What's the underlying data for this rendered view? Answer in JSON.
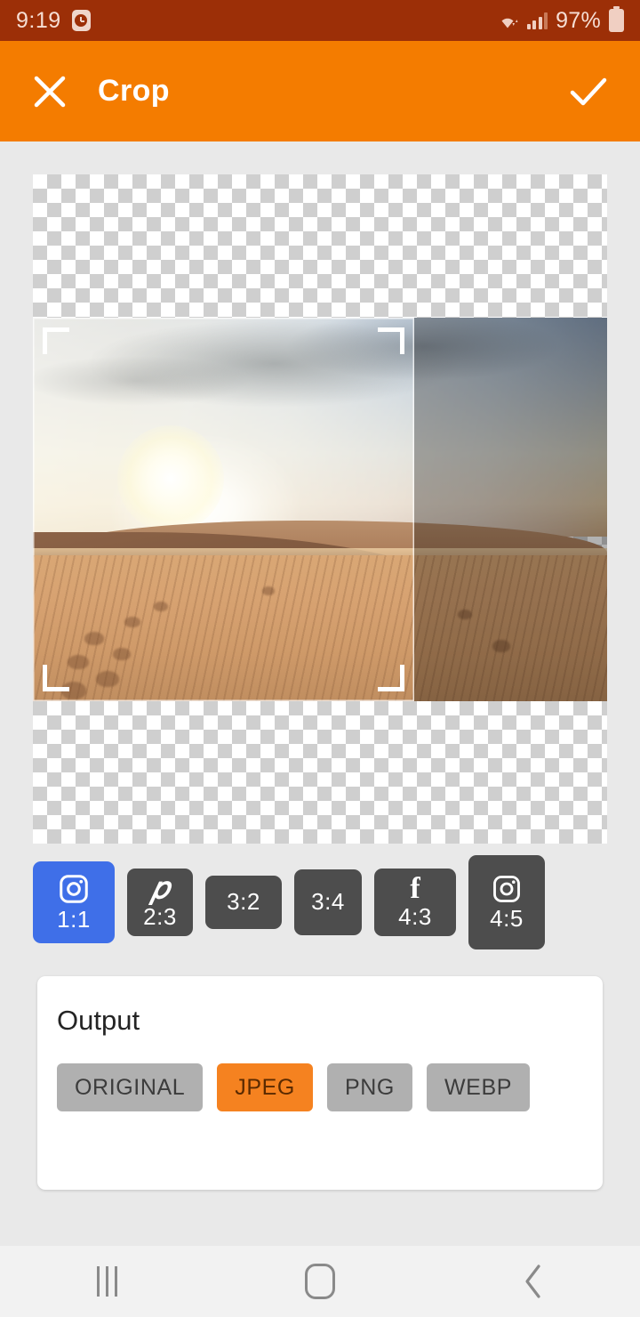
{
  "status_bar": {
    "time": "9:19",
    "alarm_icon": "alarm-clock-icon",
    "wifi_icon": "wifi-icon",
    "signal_icon": "cellular-signal-icon",
    "battery_percent": "97%",
    "battery_icon": "battery-icon",
    "background_color": "#9c2f07"
  },
  "app_bar": {
    "close_icon": "close-icon",
    "title": "Crop",
    "done_icon": "checkmark-icon",
    "background_color": "#f47c00"
  },
  "editor": {
    "canvas_background": "transparent-checkerboard",
    "image_description": "desert sand dunes at sunset with footprints in the sand",
    "crop_overlay": {
      "aspect": "1:1",
      "handles": [
        "top-left",
        "top-right",
        "bottom-left",
        "bottom-right"
      ],
      "outside_shade_color": "rgba(0,0,0,0.30)"
    }
  },
  "aspect_ratios": {
    "selected": "1:1",
    "selected_color": "#3f6fe8",
    "unselected_color": "#4d4d4d",
    "items": [
      {
        "label": "1:1",
        "icon": "instagram-icon",
        "selected": true
      },
      {
        "label": "2:3",
        "icon": "pinterest-icon",
        "selected": false
      },
      {
        "label": "3:2",
        "icon": "",
        "selected": false
      },
      {
        "label": "3:4",
        "icon": "",
        "selected": false
      },
      {
        "label": "4:3",
        "icon": "facebook-icon",
        "selected": false
      },
      {
        "label": "4:5",
        "icon": "instagram-icon",
        "selected": false
      }
    ]
  },
  "output": {
    "title": "Output",
    "selected": "JPEG",
    "selected_color": "#f58220",
    "formats": [
      {
        "label": "ORIGINAL",
        "selected": false
      },
      {
        "label": "JPEG",
        "selected": true
      },
      {
        "label": "PNG",
        "selected": false
      },
      {
        "label": "WEBP",
        "selected": false
      }
    ]
  },
  "nav_bar": {
    "recents_icon": "recents-icon",
    "home_icon": "home-icon",
    "back_icon": "back-icon"
  }
}
